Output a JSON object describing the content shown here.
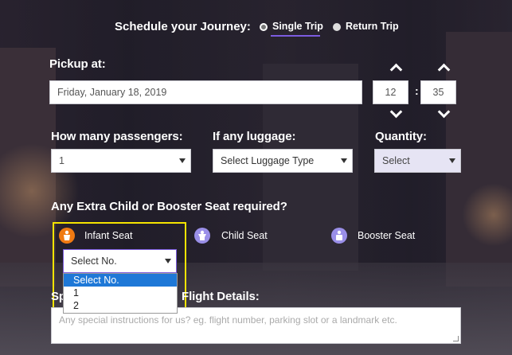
{
  "header": {
    "title": "Schedule your Journey:",
    "trip_types": [
      {
        "label": "Single Trip",
        "selected": true
      },
      {
        "label": "Return Trip",
        "selected": false
      }
    ]
  },
  "pickup": {
    "label": "Pickup at:",
    "date_value": "Friday, January 18, 2019",
    "hour": "12",
    "minute": "35"
  },
  "passengers": {
    "label": "How many passengers:",
    "value": "1"
  },
  "luggage": {
    "label": "If any luggage:",
    "value": "Select Luggage Type"
  },
  "quantity": {
    "label": "Quantity:",
    "value": "Select"
  },
  "extra_seat": {
    "label": "Any Extra Child or Booster Seat required?",
    "options": [
      {
        "label": "Infant Seat",
        "icon": "infant-seat-icon",
        "color": "#f07a12"
      },
      {
        "label": "Child Seat",
        "icon": "child-seat-icon",
        "color": "#9a8fe8"
      },
      {
        "label": "Booster Seat",
        "icon": "booster-seat-icon",
        "color": "#9a8fe8"
      }
    ],
    "select_value": "Select No.",
    "dropdown_options": [
      "Select No.",
      "1",
      "2"
    ],
    "dropdown_selected_index": 0
  },
  "instructions": {
    "label_left": "Sp",
    "label_right": "Flight Details:",
    "placeholder": "Any special instructions for us? eg. flight number, parking slot or a landmark etc."
  },
  "colors": {
    "accent": "#6a4fd6",
    "highlight_box": "#f5e400",
    "dropdown_selected": "#1e78d7",
    "quantity_bg": "#e6e4f4"
  }
}
